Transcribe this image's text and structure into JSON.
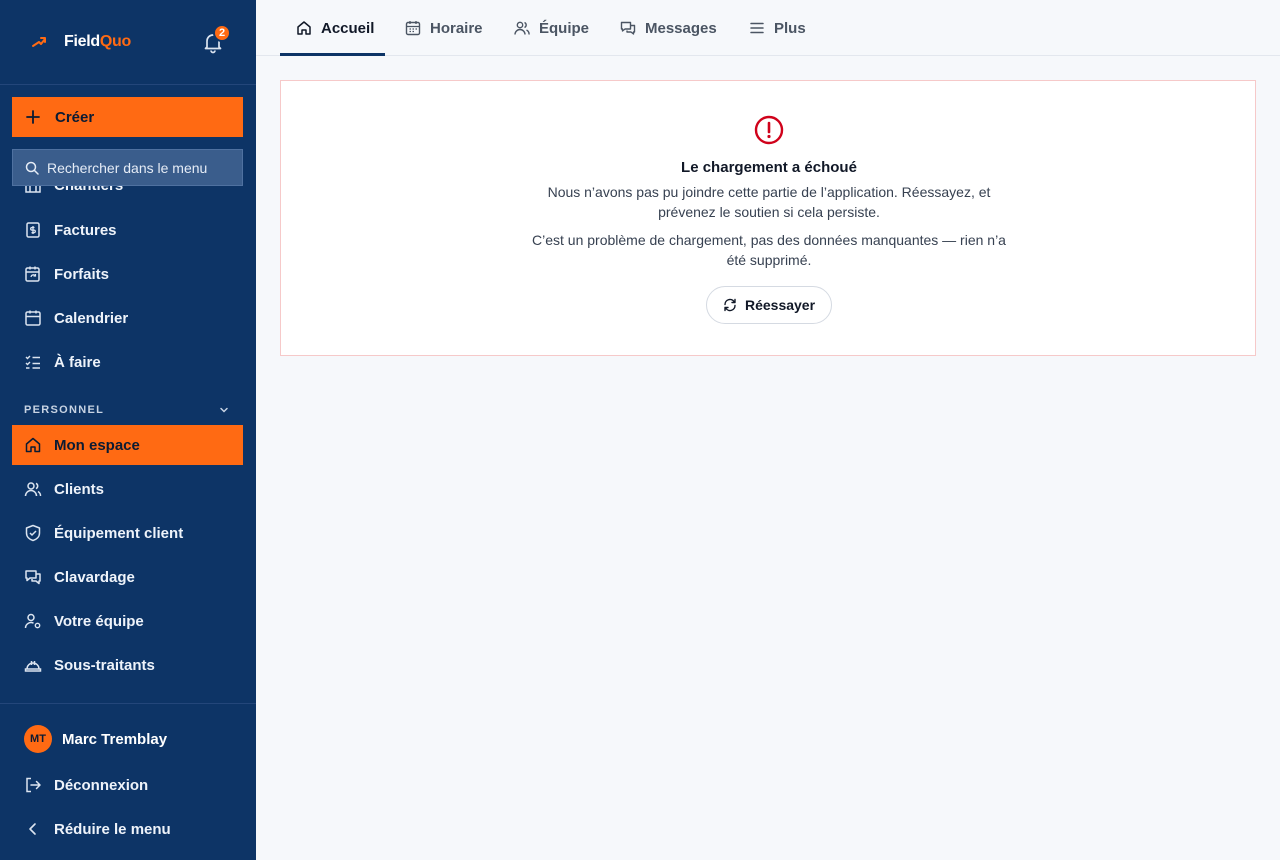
{
  "brand": {
    "name_part1": "Field",
    "name_part2": "Quo",
    "notification_count": "2"
  },
  "sidebar": {
    "create_label": "Créer",
    "search_placeholder": "Rechercher dans le menu",
    "items": [
      {
        "label": "Chantiers",
        "icon": "building-icon"
      },
      {
        "label": "Factures",
        "icon": "invoice-dollar-icon"
      },
      {
        "label": "Forfaits",
        "icon": "package-refresh-icon"
      },
      {
        "label": "Calendrier",
        "icon": "calendar-icon"
      },
      {
        "label": "À faire",
        "icon": "checklist-icon"
      }
    ],
    "section_personal": "PERSONNEL",
    "personal_items": [
      {
        "label": "Mon espace",
        "icon": "home-icon",
        "active": true
      },
      {
        "label": "Clients",
        "icon": "users-icon"
      },
      {
        "label": "Équipement client",
        "icon": "shield-check-icon"
      },
      {
        "label": "Clavardage",
        "icon": "chat-icon"
      },
      {
        "label": "Votre équipe",
        "icon": "user-gear-icon"
      },
      {
        "label": "Sous-traitants",
        "icon": "hard-hat-icon"
      }
    ],
    "footer": {
      "avatar_initials": "MT",
      "user_name": "Marc Tremblay",
      "logout_label": "Déconnexion",
      "collapse_label": "Réduire le menu"
    }
  },
  "topnav": {
    "tabs": [
      {
        "label": "Accueil",
        "icon": "home-icon",
        "active": true
      },
      {
        "label": "Horaire",
        "icon": "calendar-icon"
      },
      {
        "label": "Équipe",
        "icon": "users-icon"
      },
      {
        "label": "Messages",
        "icon": "chat-icon"
      },
      {
        "label": "Plus",
        "icon": "menu-icon"
      }
    ]
  },
  "error": {
    "title": "Le chargement a échoué",
    "message": "Nous n’avons pas pu joindre cette partie de l’application. Réessayez, et prévenez le soutien si cela persiste.",
    "note": "C’est un problème de chargement, pas des données manquantes — rien n’a été supprimé.",
    "retry_label": "Réessayer"
  },
  "colors": {
    "sidebar_bg": "#0d3466",
    "accent": "#ff6a13",
    "error": "#d0021b"
  }
}
